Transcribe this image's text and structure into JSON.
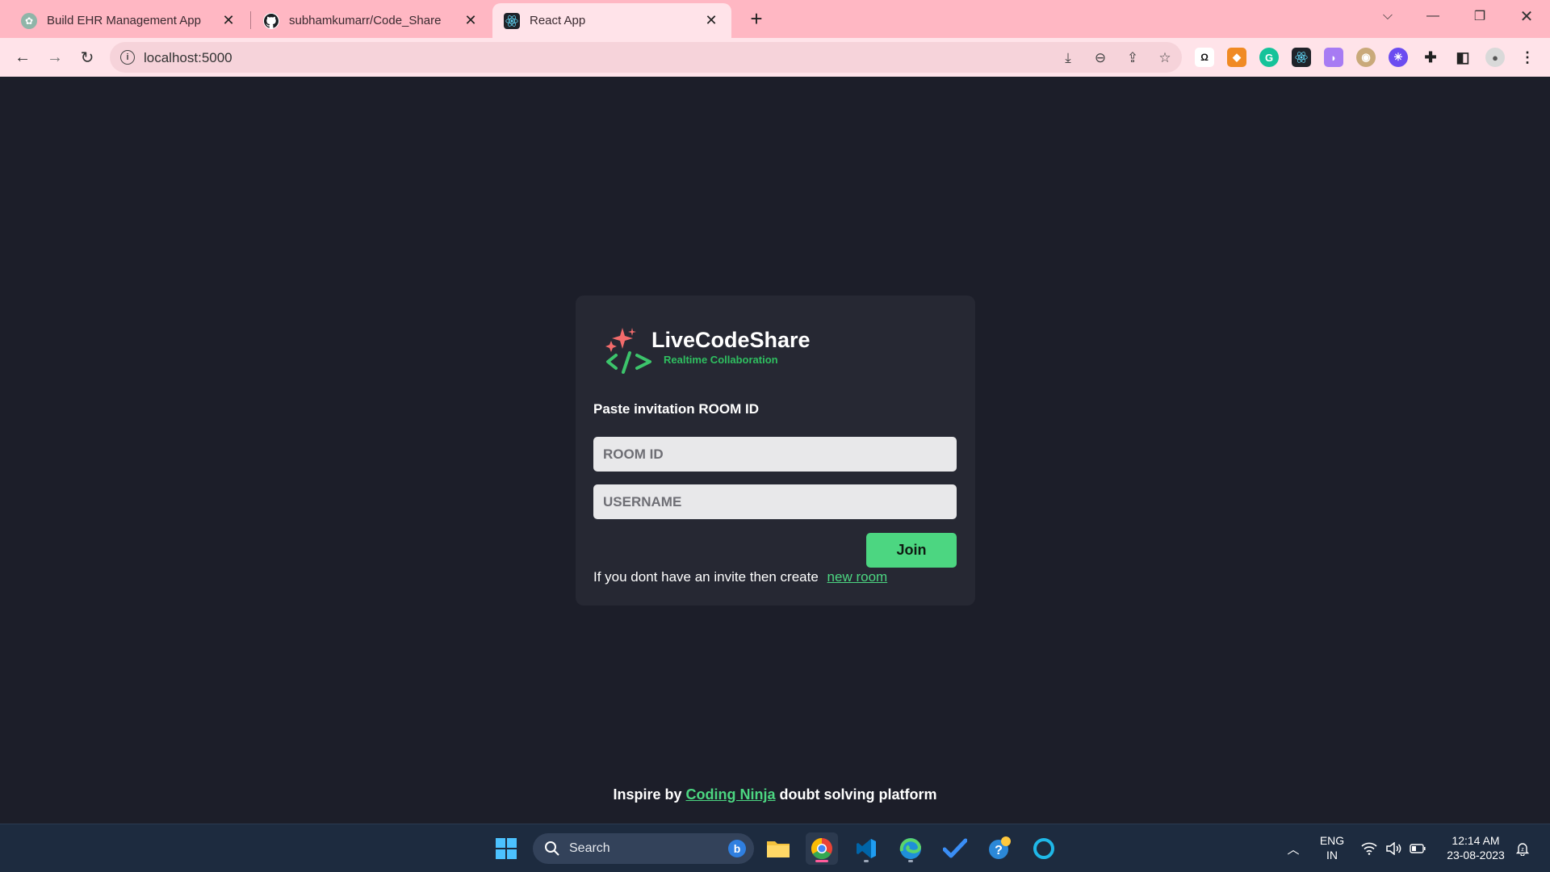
{
  "browser": {
    "tabs": [
      {
        "title": "Build EHR Management App",
        "icon": "chatgpt-icon"
      },
      {
        "title": "subhamkumarr/Code_Share",
        "icon": "github-icon"
      },
      {
        "title": "React App",
        "icon": "react-icon"
      }
    ],
    "address": "localhost:5000",
    "colors": {
      "tabbar": "#ffb7c3",
      "toolbar": "#ffe3e9"
    }
  },
  "app": {
    "brand_title": "LiveCodeShare",
    "brand_subtitle": "Realtime Collaboration",
    "invite_label": "Paste invitation ROOM ID",
    "room_placeholder": "ROOM ID",
    "username_placeholder": "USERNAME",
    "join_label": "Join",
    "create_text": "If you dont have an invite then create",
    "create_link": "new room",
    "colors": {
      "background": "#1c1e29",
      "card": "#262833",
      "accent": "#4cd681"
    }
  },
  "footer": {
    "prefix": "Inspire by",
    "link": "Coding Ninja",
    "suffix": "doubt solving platform"
  },
  "taskbar": {
    "search_label": "Search",
    "lang_top": "ENG",
    "lang_bottom": "IN",
    "time": "12:14 AM",
    "date": "23-08-2023"
  }
}
